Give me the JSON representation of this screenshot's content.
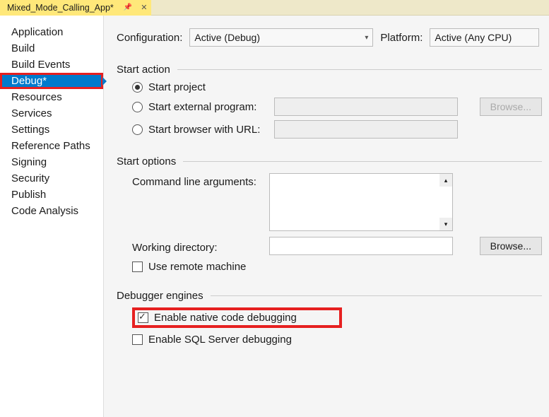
{
  "tab": {
    "title": "Mixed_Mode_Calling_App*"
  },
  "sidebar": {
    "items": [
      {
        "label": "Application"
      },
      {
        "label": "Build"
      },
      {
        "label": "Build Events"
      },
      {
        "label": "Debug*"
      },
      {
        "label": "Resources"
      },
      {
        "label": "Services"
      },
      {
        "label": "Settings"
      },
      {
        "label": "Reference Paths"
      },
      {
        "label": "Signing"
      },
      {
        "label": "Security"
      },
      {
        "label": "Publish"
      },
      {
        "label": "Code Analysis"
      }
    ],
    "selectedIndex": 3
  },
  "header": {
    "configuration_label": "Configuration:",
    "configuration_value": "Active (Debug)",
    "platform_label": "Platform:",
    "platform_value": "Active (Any CPU)"
  },
  "startAction": {
    "section": "Start action",
    "start_project": "Start project",
    "start_external": "Start external program:",
    "start_browser": "Start browser with URL:",
    "browse": "Browse..."
  },
  "startOptions": {
    "section": "Start options",
    "cmdline": "Command line arguments:",
    "workdir": "Working directory:",
    "browse": "Browse...",
    "remote": "Use remote machine"
  },
  "debuggerEngines": {
    "section": "Debugger engines",
    "native": "Enable native code debugging",
    "sql": "Enable SQL Server debugging"
  }
}
